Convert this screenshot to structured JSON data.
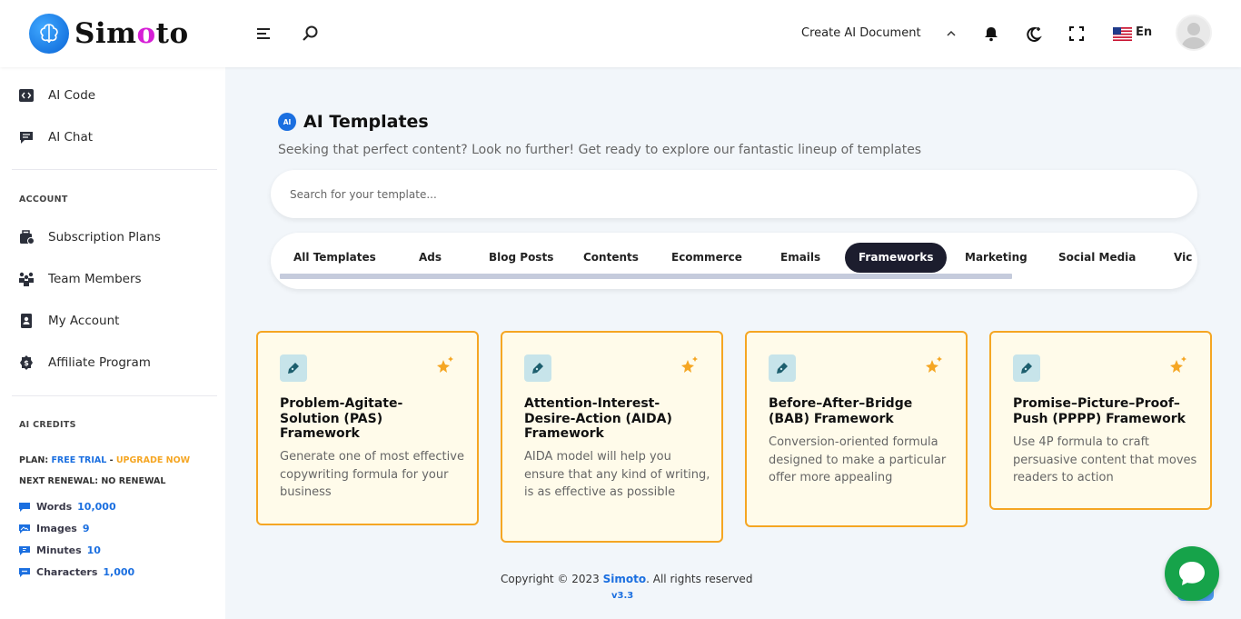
{
  "app": {
    "logo_text": "Simoto",
    "accent": "#1b6fe0",
    "highlight": "#d61fd6"
  },
  "header": {
    "create_doc_label": "Create AI Document",
    "lang_label": "En",
    "icons": [
      "menu-icon",
      "search-icon",
      "chevron-up-icon",
      "bell-icon",
      "dark-mode-icon",
      "fullscreen-icon",
      "us-flag-icon",
      "avatar"
    ]
  },
  "sidebar": {
    "items": [
      {
        "label": "AI Code",
        "icon": "code-icon"
      },
      {
        "label": "AI Chat",
        "icon": "chat-icon"
      }
    ],
    "account_title": "ACCOUNT",
    "account_items": [
      {
        "label": "Subscription Plans",
        "icon": "subscription-icon"
      },
      {
        "label": "Team Members",
        "icon": "team-icon"
      },
      {
        "label": "My Account",
        "icon": "account-icon"
      },
      {
        "label": "Affiliate Program",
        "icon": "affiliate-icon"
      }
    ],
    "credits_title": "AI CREDITS",
    "plan_label": "PLAN:",
    "plan_value": "FREE TRIAL",
    "plan_sep": " - ",
    "upgrade_label": "UPGRADE NOW",
    "renewal_label": "NEXT RENEWAL: NO RENEWAL",
    "credits": [
      {
        "label": "Words",
        "value": "10,000"
      },
      {
        "label": "Images",
        "value": "9"
      },
      {
        "label": "Minutes",
        "value": "10"
      },
      {
        "label": "Characters",
        "value": "1,000"
      }
    ]
  },
  "main": {
    "badge": "AI",
    "title": "AI Templates",
    "subtitle": "Seeking that perfect content? Look no further! Get ready to explore our fantastic lineup of templates",
    "search_placeholder": "Search for your template...",
    "tabs": [
      "All Templates",
      "Ads",
      "Blog Posts",
      "Contents",
      "Ecommerce",
      "Emails",
      "Frameworks",
      "Marketing",
      "Social Media",
      "Vic"
    ],
    "active_tab": "Frameworks",
    "cards": [
      {
        "title": "Problem-Agitate-Solution (PAS) Framework",
        "desc": "Generate one of most effective copywriting formula for your business"
      },
      {
        "title": "Attention-Interest-Desire-Action (AIDA) Framework",
        "desc": "AIDA model will help you ensure that any kind of writing, is as effective as possible"
      },
      {
        "title": "Before–After–Bridge (BAB) Framework",
        "desc": "Conversion-oriented formula designed to make a particular offer more appealing"
      },
      {
        "title": "Promise–Picture–Proof–Push (PPPP) Framework",
        "desc": "Use 4P formula to craft persuasive content that moves readers to action"
      }
    ]
  },
  "footer": {
    "copyright_prefix": "Copyright © 2023",
    "brand": "Simoto",
    "copyright_suffix": ". All rights reserved",
    "version": "v3.3"
  }
}
